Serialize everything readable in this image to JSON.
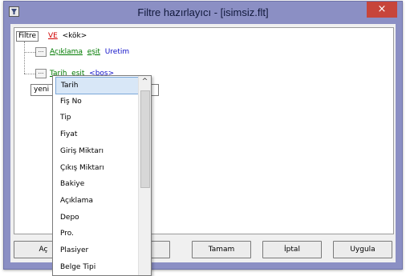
{
  "window": {
    "title": "Filtre hazırlayıcı - [isimsiz.flt]",
    "close_glyph": "×"
  },
  "tree": {
    "root": {
      "label": "Filtre",
      "operator": "VE",
      "node": "<kök>"
    },
    "conditions": [
      {
        "ellipsis": "...",
        "field": "Açıklama",
        "op": "eşit",
        "value": "Uretim"
      },
      {
        "ellipsis": "...",
        "field": "Tarih",
        "op": "eşit",
        "value": "<boş>"
      }
    ],
    "new_item_value": "yeni"
  },
  "dropdown": {
    "items": [
      "Tarih",
      "Fiş No",
      "Tip",
      "Fiyat",
      "Giriş Miktarı",
      "Çıkış Miktarı",
      "Bakiye",
      "Açıklama",
      "Depo",
      "Pro.",
      "Plasiyer",
      "Belge Tipi"
    ],
    "selected": "Tarih",
    "scroll_up_glyph": "^"
  },
  "buttons": {
    "left_partial": "Aç",
    "tamam": "Tamam",
    "iptal": "İptal",
    "uygula": "Uygula"
  },
  "colors": {
    "title_bar": "#8b8fc4",
    "close": "#c7453a",
    "operator": "#d00000",
    "keyword": "#007a00",
    "value": "#1010c8",
    "selection": "#d8e7f7"
  }
}
